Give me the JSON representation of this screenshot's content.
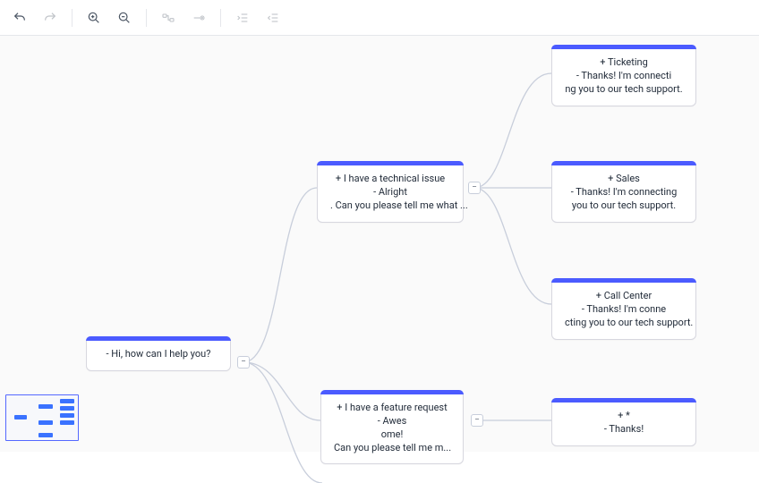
{
  "toolbar": {
    "undo": "undo",
    "redo": "redo",
    "zoom_in": "zoom-in",
    "zoom_out": "zoom-out",
    "add_child": "add-child",
    "add_sibling": "add-sibling",
    "indent": "indent",
    "outdent": "outdent"
  },
  "nodes": {
    "root": {
      "line1": "- Hi, how can I help you?"
    },
    "tech": {
      "line1": "+ I have a technical issue",
      "line2": "- Alright",
      "line3": ". Can you please tell me what ..."
    },
    "feature": {
      "line1": "+ I have a feature request",
      "line2": "- Awes",
      "line3": "ome!",
      "line4": "Can you please tell me m..."
    },
    "ticketing": {
      "line1": "+ Ticketing",
      "line2": "- Thanks! I'm connecti",
      "line3": "ng you to our tech support."
    },
    "sales": {
      "line1": "+ Sales",
      "line2": "- Thanks! I'm connecting",
      "line3": "you to our tech support."
    },
    "callcenter": {
      "line1": "+ Call Center",
      "line2": "- Thanks! I'm conne",
      "line3": "cting you to our tech support."
    },
    "star": {
      "line1": "+ *",
      "line2": "- Thanks!"
    }
  },
  "toggles": {
    "collapse": "−",
    "expand": "+"
  }
}
